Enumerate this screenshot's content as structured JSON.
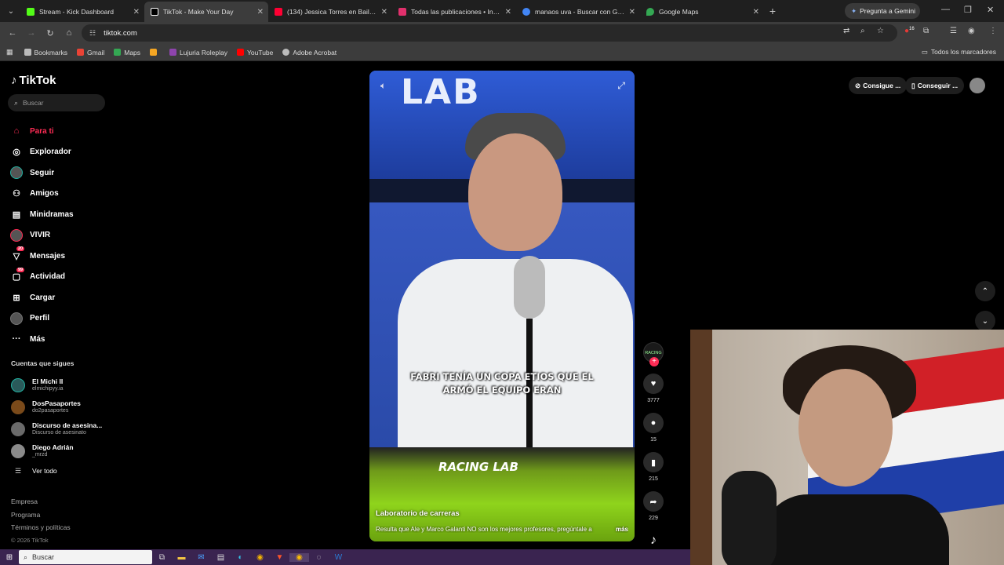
{
  "browser": {
    "tabs": [
      {
        "title": "Stream - Kick Dashboard",
        "color": "#53fc18",
        "active": false
      },
      {
        "title": "TikTok - Make Your Day",
        "color": "#ffffff",
        "active": true
      },
      {
        "title": "(134) Jessica Torres en Baila con",
        "color": "#ff0033",
        "active": false
      },
      {
        "title": "Todas las publicaciones • Instag",
        "color": "#e1306c",
        "active": false
      },
      {
        "title": "manaos uva - Buscar con Goog",
        "color": "#4285f4",
        "active": false
      },
      {
        "title": "Google Maps",
        "color": "#34a853",
        "active": false
      }
    ],
    "gemini_label": "Pregunta a Gemini",
    "url": "tiktok.com",
    "extension_badge": "16",
    "bookmarks": [
      {
        "label": "Bookmarks",
        "color": "#bbbbbb"
      },
      {
        "label": "Gmail",
        "color": "#ea4335"
      },
      {
        "label": "Maps",
        "color": "#34a853"
      },
      {
        "label": "",
        "color": "#f5a623"
      },
      {
        "label": "Lujuria Roleplay",
        "color": "#8e44ad"
      },
      {
        "label": "YouTube",
        "color": "#ff0000"
      },
      {
        "label": "Adobe Acrobat",
        "color": "#bbbbbb"
      }
    ],
    "all_bookmarks_label": "Todos los marcadores"
  },
  "tiktok": {
    "logo": "TikTok",
    "search_placeholder": "Buscar",
    "nav": [
      {
        "label": "Para ti",
        "icon": "home-icon",
        "active": true
      },
      {
        "label": "Explorador",
        "icon": "compass-icon"
      },
      {
        "label": "Seguir",
        "icon": "following-icon"
      },
      {
        "label": "Amigos",
        "icon": "friends-icon"
      },
      {
        "label": "Minidramas",
        "icon": "film-icon"
      },
      {
        "label": "VIVIR",
        "icon": "live-icon"
      },
      {
        "label": "Mensajes",
        "icon": "messages-icon",
        "badge": "20"
      },
      {
        "label": "Actividad",
        "icon": "activity-icon",
        "badge": "99"
      },
      {
        "label": "Cargar",
        "icon": "upload-icon"
      },
      {
        "label": "Perfil",
        "icon": "profile-icon"
      },
      {
        "label": "Más",
        "icon": "more-icon"
      }
    ],
    "following_title": "Cuentas que sigues",
    "following": [
      {
        "name": "El Michi II",
        "handle": "elmichipyy.ia"
      },
      {
        "name": "DosPasaportes",
        "handle": "do2pasaportes"
      },
      {
        "name": "Discurso de asesina...",
        "handle": "Discurso de asesinato"
      },
      {
        "name": "Diego Adrián",
        "handle": "_mrzd"
      }
    ],
    "see_all": "Ver todo",
    "footer": {
      "links": [
        "Empresa",
        "Programa",
        "Términos y políticas"
      ],
      "copyright": "© 2026 TikTok"
    },
    "top_buttons": [
      "Consigue ...",
      "Conseguir ..."
    ],
    "video": {
      "overlay_caption_line1": "FABRI TENÍA UN COPA ETIOS QUE EL",
      "overlay_caption_line2": "ARMÓ EL EQUIPO ERAN",
      "banner_text": "LAB",
      "brand_text": "RACING LAB",
      "author": "Laboratorio de carreras",
      "description": "Resulta que Ale y Marco Galanti NO son los mejores profesores, pregúntale a",
      "more": "más"
    },
    "actions": {
      "creator_badge": "RACING",
      "likes": "3777",
      "comments": "15",
      "saves": "215",
      "shares": "229"
    }
  },
  "taskbar": {
    "search_placeholder": "Buscar"
  }
}
